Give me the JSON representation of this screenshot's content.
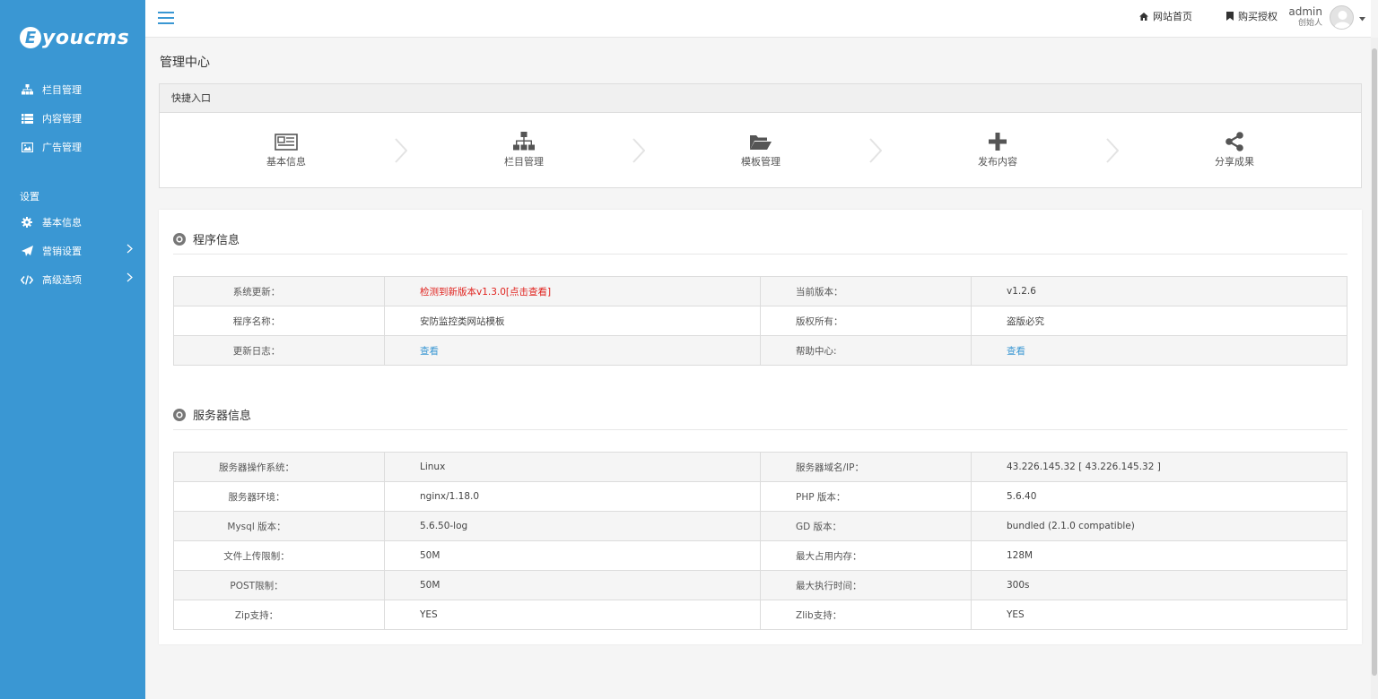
{
  "brand": {
    "logo_letter": "E",
    "logo_text": "youcms"
  },
  "sidebar": {
    "items": [
      {
        "label": "栏目管理",
        "icon": "sitemap-icon"
      },
      {
        "label": "内容管理",
        "icon": "list-icon"
      },
      {
        "label": "广告管理",
        "icon": "image-icon"
      }
    ],
    "section_label": "设置",
    "settings": [
      {
        "label": "基本信息",
        "icon": "gear-icon"
      },
      {
        "label": "营销设置",
        "icon": "paper-plane-icon"
      },
      {
        "label": "高级选项",
        "icon": "code-icon"
      }
    ]
  },
  "topbar": {
    "home_link": "网站首页",
    "buy_link": "购买授权",
    "user_name": "admin",
    "user_role": "创始人"
  },
  "page": {
    "title": "管理中心"
  },
  "quick": {
    "title": "快捷入口",
    "items": [
      {
        "label": "基本信息",
        "icon": "newspaper-icon"
      },
      {
        "label": "栏目管理",
        "icon": "sitemap-icon"
      },
      {
        "label": "模板管理",
        "icon": "folder-open-icon"
      },
      {
        "label": "发布内容",
        "icon": "plus-icon"
      },
      {
        "label": "分享成果",
        "icon": "share-icon"
      }
    ]
  },
  "program": {
    "title": "程序信息",
    "rows": [
      [
        "系统更新：",
        "检测到新版本v1.3.0[点击查看]",
        "当前版本：",
        "v1.2.6"
      ],
      [
        "程序名称：",
        "安防监控类网站模板",
        "版权所有：",
        "盗版必究"
      ],
      [
        "更新日志：",
        "查看",
        "帮助中心:",
        "查看"
      ]
    ]
  },
  "server": {
    "title": "服务器信息",
    "rows": [
      [
        "服务器操作系统：",
        "Linux",
        "服务器域名/IP：",
        "43.226.145.32 [ 43.226.145.32 ]"
      ],
      [
        "服务器环境：",
        "nginx/1.18.0",
        "PHP 版本：",
        "5.6.40"
      ],
      [
        "Mysql 版本：",
        "5.6.50-log",
        "GD 版本：",
        "bundled (2.1.0 compatible)"
      ],
      [
        "文件上传限制：",
        "50M",
        "最大占用内存：",
        "128M"
      ],
      [
        "POST限制：",
        "50M",
        "最大执行时间：",
        "300s"
      ],
      [
        "Zip支持：",
        "YES",
        "Zlib支持：",
        "YES"
      ]
    ]
  },
  "colors": {
    "accent": "#3a97d3",
    "alert": "#e0221e"
  }
}
